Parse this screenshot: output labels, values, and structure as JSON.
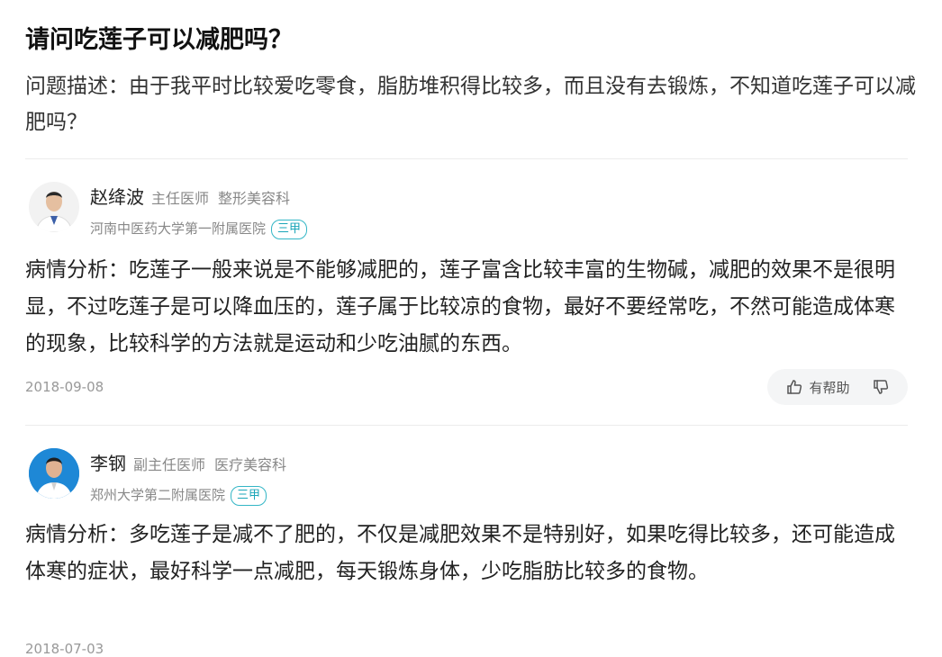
{
  "question": {
    "title": "请问吃莲子可以减肥吗？",
    "description": "问题描述：由于我平时比较爱吃零食，脂肪堆积得比较多，而且没有去锻炼，不知道吃莲子可以减肥吗？"
  },
  "answers": [
    {
      "doctor_name": "赵绛波",
      "doctor_title": "主任医师",
      "department": "整形美容科",
      "hospital": "河南中医药大学第一附属医院",
      "hospital_level": "三甲",
      "analysis": "病情分析：吃莲子一般来说是不能够减肥的，莲子富含比较丰富的生物碱，减肥的效果不是很明显，不过吃莲子是可以降血压的，莲子属于比较凉的食物，最好不要经常吃，不然可能造成体寒的现象，比较科学的方法就是运动和少吃油腻的东西。",
      "date": "2018-09-08",
      "helpful_label": "有帮助"
    },
    {
      "doctor_name": "李钢",
      "doctor_title": "副主任医师",
      "department": "医疗美容科",
      "hospital": "郑州大学第二附属医院",
      "hospital_level": "三甲",
      "analysis": "病情分析：多吃莲子是减不了肥的，不仅是减肥效果不是特别好，如果吃得比较多，还可能造成体寒的症状，最好科学一点减肥，每天锻炼身体，少吃脂肪比较多的食物。",
      "date": "2018-07-03"
    }
  ],
  "icons": {
    "thumb_up": "thumb-up-icon",
    "thumb_down": "thumb-down-icon"
  },
  "colors": {
    "badge": "#1aa5b8",
    "avatar2_bg": "#1e88d6"
  }
}
